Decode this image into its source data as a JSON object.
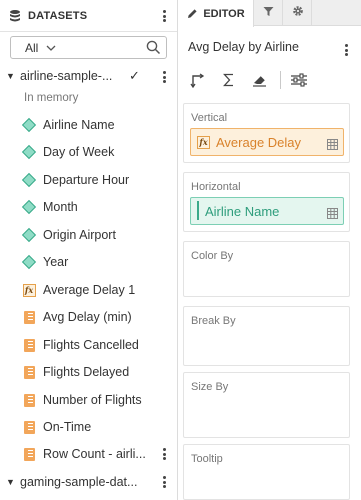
{
  "datasets_panel": {
    "title": "DATASETS",
    "filter": {
      "selected": "All"
    },
    "datasets": [
      {
        "name": "airline-sample-...",
        "expanded": true,
        "selected": true,
        "subtitle": "In memory"
      },
      {
        "name": "gaming-sample-dat...",
        "expanded": false
      }
    ],
    "fields": [
      {
        "label": "Airline Name",
        "type": "dimension"
      },
      {
        "label": "Day of Week",
        "type": "dimension"
      },
      {
        "label": "Departure Hour",
        "type": "dimension"
      },
      {
        "label": "Month",
        "type": "dimension"
      },
      {
        "label": "Origin Airport",
        "type": "dimension"
      },
      {
        "label": "Year",
        "type": "dimension"
      },
      {
        "label": "Average Delay 1",
        "type": "calculated"
      },
      {
        "label": "Avg Delay (min)",
        "type": "measure"
      },
      {
        "label": "Flights Cancelled",
        "type": "measure"
      },
      {
        "label": "Flights Delayed",
        "type": "measure"
      },
      {
        "label": "Number of Flights",
        "type": "measure"
      },
      {
        "label": "On-Time",
        "type": "measure"
      },
      {
        "label": "Row Count - airli...",
        "type": "measure"
      }
    ]
  },
  "editor_panel": {
    "tabs": [
      {
        "label": "EDITOR",
        "icon": "pencil-icon",
        "active": true
      },
      {
        "label": "",
        "icon": "filter-icon",
        "active": false
      },
      {
        "label": "",
        "icon": "gear-icon",
        "active": false
      }
    ],
    "visualization_title": "Avg Delay by Airline",
    "toolbar": [
      "swap-axes-icon",
      "sigma-icon",
      "eraser-icon",
      "sliders-icon"
    ],
    "zones": [
      {
        "label": "Vertical",
        "field": {
          "label": "Average Delay",
          "type": "calculated",
          "color": "#d9822b"
        }
      },
      {
        "label": "Horizontal",
        "field": {
          "label": "Airline Name",
          "type": "dimension",
          "color": "#2e9d7c"
        }
      },
      {
        "label": "Color By",
        "field": null
      },
      {
        "label": "Break By",
        "field": null
      },
      {
        "label": "Size By",
        "field": null
      },
      {
        "label": "Tooltip",
        "field": null
      }
    ]
  },
  "colors": {
    "dimension": "#3aaa8a",
    "measure": "#f2a65a",
    "calculated": "#e5a04a"
  }
}
